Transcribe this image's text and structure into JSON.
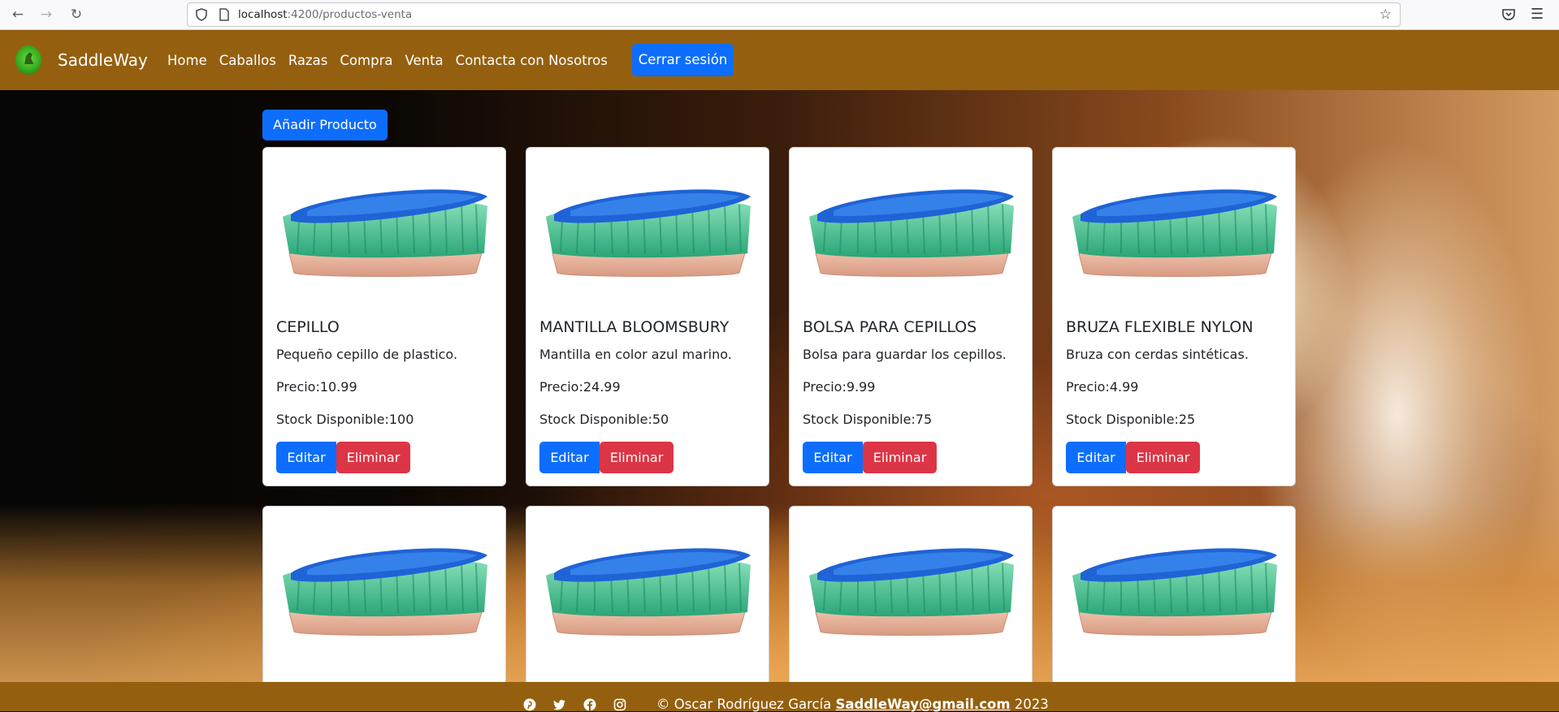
{
  "browser": {
    "url_host": "localhost",
    "url_path": ":4200/productos-venta",
    "back_icon": "arrow-left-icon",
    "forward_icon": "arrow-right-icon",
    "reload_icon": "reload-icon"
  },
  "navbar": {
    "brand": "SaddleWay",
    "links": [
      "Home",
      "Caballos",
      "Razas",
      "Compra",
      "Venta",
      "Contacta con Nosotros"
    ],
    "logout_label": "Cerrar sesión",
    "bg_color": "#94600f"
  },
  "main": {
    "add_label": "Añadir Producto"
  },
  "products": [
    {
      "title": "CEPILLO",
      "desc": "Pequeño cepillo de plastico.",
      "price": "Precio:10.99",
      "stock": "Stock Disponible:100",
      "edit": "Editar",
      "delete": "Eliminar"
    },
    {
      "title": "MANTILLA BLOOMSBURY",
      "desc": "Mantilla en color azul marino.",
      "price": "Precio:24.99",
      "stock": "Stock Disponible:50",
      "edit": "Editar",
      "delete": "Eliminar"
    },
    {
      "title": "BOLSA PARA CEPILLOS",
      "desc": "Bolsa para guardar los cepillos.",
      "price": "Precio:9.99",
      "stock": "Stock Disponible:75",
      "edit": "Editar",
      "delete": "Eliminar"
    },
    {
      "title": "BRUZA FLEXIBLE NYLON",
      "desc": "Bruza con cerdas sintéticas.",
      "price": "Precio:4.99",
      "stock": "Stock Disponible:25",
      "edit": "Editar",
      "delete": "Eliminar"
    }
  ],
  "footer": {
    "author": "© Oscar Rodríguez García",
    "email": "SaddleWay@gmail.com",
    "year": "2023",
    "icons": [
      "pinterest-icon",
      "twitter-icon",
      "facebook-icon",
      "instagram-icon"
    ]
  },
  "colors": {
    "primary": "#0d6efd",
    "danger": "#dc3545",
    "brand": "#94600f"
  }
}
